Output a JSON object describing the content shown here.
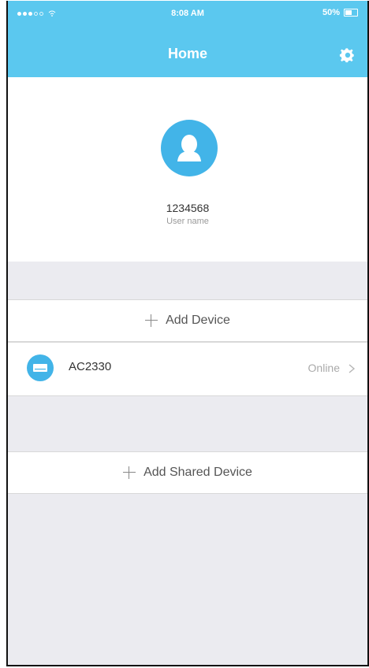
{
  "status_bar": {
    "time": "8:08 AM",
    "battery": "50%"
  },
  "header": {
    "title": "Home",
    "settings_icon": "gear-icon"
  },
  "profile": {
    "user_id": "1234568",
    "user_label": "User name",
    "avatar_icon": "user-avatar-icon"
  },
  "actions": {
    "add_device": "Add Device",
    "add_shared_device": "Add Shared Device"
  },
  "device": {
    "name": "AC2330",
    "status": "Online",
    "icon": "air-conditioner-icon"
  },
  "colors": {
    "header_blue": "#5bc8ef",
    "icon_blue": "#42b4e8",
    "background": "#ebebf0",
    "panel_white": "#ffffff"
  }
}
